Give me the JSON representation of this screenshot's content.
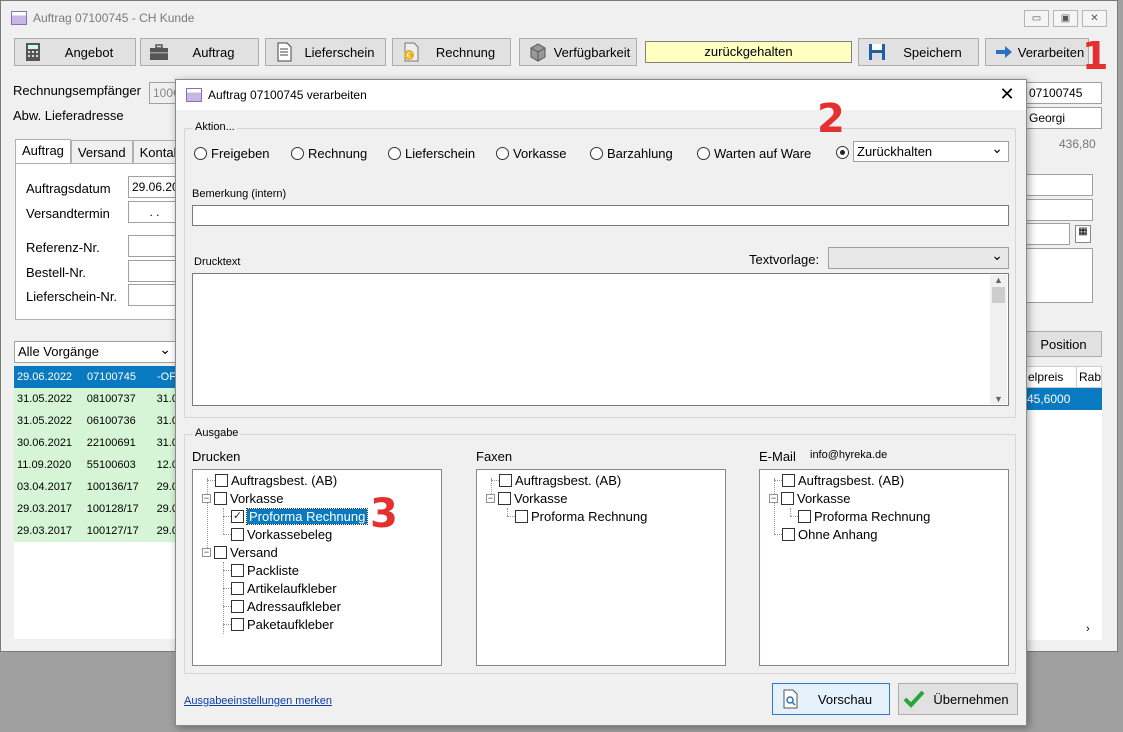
{
  "window": {
    "title": "Auftrag 07100745 - CH Kunde"
  },
  "toolbar": {
    "angebot": "Angebot",
    "auftrag": "Auftrag",
    "lieferschein": "Lieferschein",
    "rechnung": "Rechnung",
    "verfuegbarkeit": "Verfügbarkeit",
    "status": "zurückgehalten",
    "speichern": "Speichern",
    "verarbeiten": "Verarbeiten"
  },
  "header": {
    "rechnungsempfaenger_label": "Rechnungsempfänger",
    "rechnungsempfaenger_value": "100€",
    "abw_lieferadresse_label": "Abw. Lieferadresse",
    "order_no": "07100745",
    "name": "Georgi",
    "amount": "436,80"
  },
  "tabs": [
    "Auftrag",
    "Versand",
    "Kontakt"
  ],
  "form": {
    "auftragsdatum_label": "Auftragsdatum",
    "auftragsdatum_value": "29.06.20",
    "versandtermin_label": "Versandtermin",
    "versandtermin_value": ". .",
    "referenz_label": "Referenz-Nr.",
    "bestell_label": "Bestell-Nr.",
    "lieferschein_label": "Lieferschein-Nr."
  },
  "filter": {
    "selected": "Alle Vorgänge"
  },
  "right": {
    "position_button": "Position",
    "col_einzelpreis": "elpreis",
    "col_rabatt": "Rab",
    "row_value": "45,6000"
  },
  "rows": [
    {
      "date": "29.06.2022",
      "no": "07100745",
      "extra": "-OF"
    },
    {
      "date": "31.05.2022",
      "no": "08100737",
      "extra": "31.0"
    },
    {
      "date": "31.05.2022",
      "no": "06100736",
      "extra": "31.0"
    },
    {
      "date": "30.06.2021",
      "no": "22100691",
      "extra": "31.0"
    },
    {
      "date": "11.09.2020",
      "no": "55100603",
      "extra": "12.0"
    },
    {
      "date": "03.04.2017",
      "no": "100136/17",
      "extra": "29.0"
    },
    {
      "date": "29.03.2017",
      "no": "100128/17",
      "extra": "29.0"
    },
    {
      "date": "29.03.2017",
      "no": "100127/17",
      "extra": "29.0"
    }
  ],
  "dialog": {
    "title": "Auftrag 07100745 verarbeiten",
    "aktion_label": "Aktion...",
    "options": [
      "Freigeben",
      "Rechnung",
      "Lieferschein",
      "Vorkasse",
      "Barzahlung",
      "Warten auf Ware"
    ],
    "zurueck_value": "Zurückhalten",
    "bemerkung_label": "Bemerkung (intern)",
    "drucktext_label": "Drucktext",
    "textvorlage_label": "Textvorlage:",
    "ausgabe_label": "Ausgabe",
    "drucken_label": "Drucken",
    "faxen_label": "Faxen",
    "email_label": "E-Mail",
    "email_value": "info@hyreka.de",
    "drucken_tree": [
      "Auftragsbest. (AB)",
      "Vorkasse",
      "Proforma Rechnung",
      "Vorkassebeleg",
      "Versand",
      "Packliste",
      "Artikelaufkleber",
      "Adressaufkleber",
      "Paketaufkleber"
    ],
    "faxen_tree": [
      "Auftragsbest. (AB)",
      "Vorkasse",
      "Proforma Rechnung"
    ],
    "email_tree": [
      "Auftragsbest. (AB)",
      "Vorkasse",
      "Proforma Rechnung",
      "Ohne Anhang"
    ],
    "merken_link": "Ausgabeeinstellungen merken",
    "vorschau": "Vorschau",
    "uebernehmen": "Übernehmen"
  },
  "annotations": [
    "1",
    "2",
    "3"
  ],
  "colors": {
    "selected_row": "#0a7ac0",
    "green_row": "#d6f5d6",
    "status_bg": "#ffffc0",
    "annotation": "#e53030"
  }
}
